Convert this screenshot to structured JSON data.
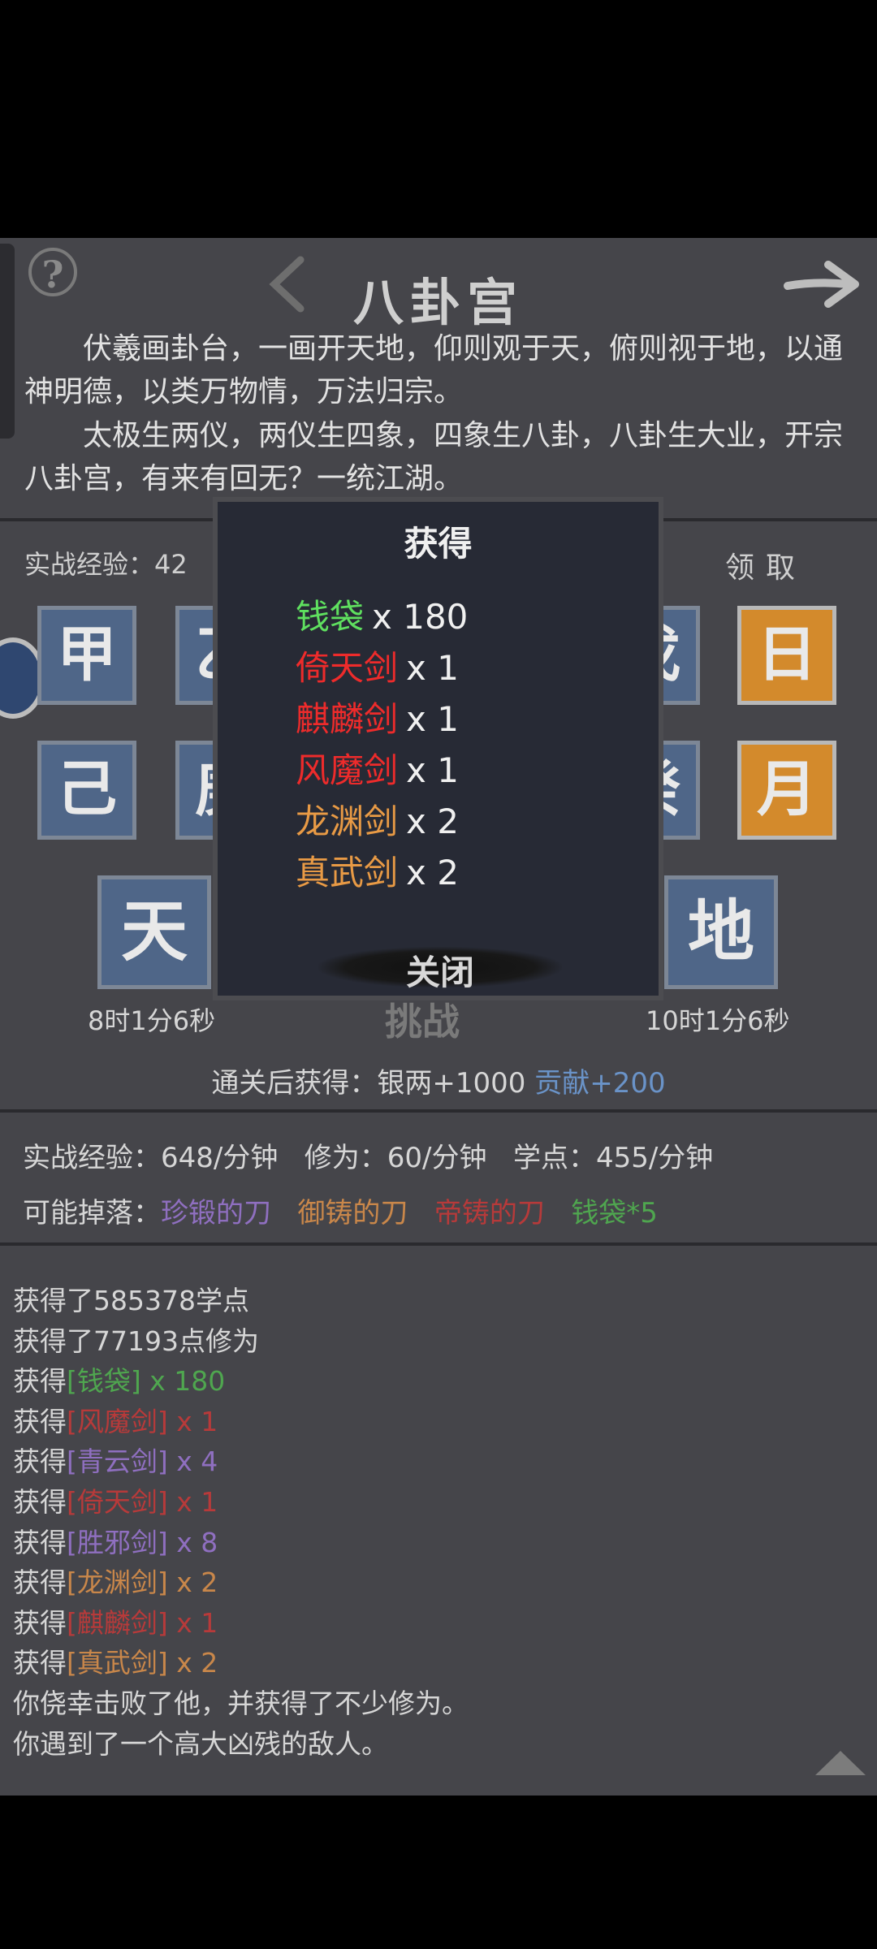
{
  "header": {
    "title": "八卦宫"
  },
  "description": {
    "paragraph1": "　　伏羲画卦台，一画开天地，仰则观于天，俯则视于地，以通神明德，以类万物情，万法归宗。",
    "paragraph2": "　　太极生两仪，两仪生四象，四象生八卦，八卦生大业，开宗八卦宫，有来有回无？一统江湖。"
  },
  "experience": {
    "label": "实战经验：42",
    "claim_label": "领取"
  },
  "tiles": {
    "row1": [
      "甲",
      "乙",
      "戊",
      "日"
    ],
    "row2": [
      "己",
      "庚",
      "癸",
      "月"
    ],
    "heaven": "天",
    "earth": "地"
  },
  "timers": {
    "left": "8时1分6秒",
    "right": "10时1分6秒"
  },
  "challenge_label": "挑战",
  "reward": {
    "prefix": "通关后获得：银两+1000",
    "bonus": "贡献+200"
  },
  "stats": {
    "battle_exp": "实战经验：648/分钟",
    "cultivation": "修为：60/分钟",
    "study_points": "学点：455/分钟"
  },
  "drops": {
    "label": "可能掉落：",
    "items": [
      {
        "name": "珍锻的刀",
        "color": "#8f6fc0"
      },
      {
        "name": "御铸的刀",
        "color": "#c9874a"
      },
      {
        "name": "帝铸的刀",
        "color": "#b73a3a"
      },
      {
        "name": "钱袋*5",
        "color": "#4fa64f"
      }
    ]
  },
  "log": [
    {
      "prefix": "获得了585378学点",
      "item": "",
      "suffix": "",
      "color": ""
    },
    {
      "prefix": "获得了77193点修为",
      "item": "",
      "suffix": "",
      "color": ""
    },
    {
      "prefix": "获得",
      "item": "[钱袋]",
      "suffix": " x 180",
      "color": "#4fa64f"
    },
    {
      "prefix": "获得",
      "item": "[风魔剑]",
      "suffix": " x 1",
      "color": "#b73a3a"
    },
    {
      "prefix": "获得",
      "item": "[青云剑]",
      "suffix": " x 4",
      "color": "#8f6fc0"
    },
    {
      "prefix": "获得",
      "item": "[倚天剑]",
      "suffix": " x 1",
      "color": "#b73a3a"
    },
    {
      "prefix": "获得",
      "item": "[胜邪剑]",
      "suffix": " x 8",
      "color": "#8f6fc0"
    },
    {
      "prefix": "获得",
      "item": "[龙渊剑]",
      "suffix": " x 2",
      "color": "#c9874a"
    },
    {
      "prefix": "获得",
      "item": "[麒麟剑]",
      "suffix": " x 1",
      "color": "#b73a3a"
    },
    {
      "prefix": "获得",
      "item": "[真武剑]",
      "suffix": " x 2",
      "color": "#c9874a"
    },
    {
      "prefix": "你侥幸击败了他，并获得了不少修为。",
      "item": "",
      "suffix": "",
      "color": ""
    },
    {
      "prefix": "你遇到了一个高大凶残的敌人。",
      "item": "",
      "suffix": "",
      "color": ""
    }
  ],
  "modal": {
    "title": "获得",
    "items": [
      {
        "name": "钱袋",
        "qty": "x 180",
        "color": "#5fe05f"
      },
      {
        "name": "倚天剑",
        "qty": "x 1",
        "color": "#ee2b2b"
      },
      {
        "name": "麒麟剑",
        "qty": "x 1",
        "color": "#ee2b2b"
      },
      {
        "name": "风魔剑",
        "qty": "x 1",
        "color": "#ee2b2b"
      },
      {
        "name": "龙渊剑",
        "qty": "x 2",
        "color": "#e89a45"
      },
      {
        "name": "真武剑",
        "qty": "x 2",
        "color": "#e89a45"
      }
    ],
    "close_label": "关闭"
  },
  "colors": {
    "background": "#45454a",
    "tile_blue": "#4f6688",
    "tile_gold": "#d38a2c",
    "modal_bg": "#272a35"
  }
}
